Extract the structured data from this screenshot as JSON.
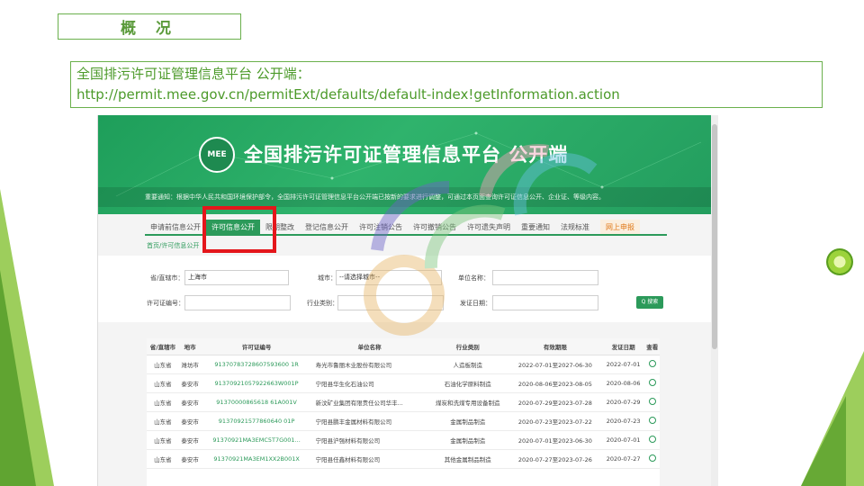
{
  "slide": {
    "title": "概 况",
    "info_line1": "全国排污许可证管理信息平台 公开端：",
    "info_line2": "http://permit.mee.gov.cn/permitExt/defaults/default-index!getInformation.action"
  },
  "site": {
    "logo_text": "MEE",
    "banner_title": "全国排污许可证管理信息平台 公开端",
    "notice": "重要通知：根据中华人民共和国环境保护部令，全国排污许可证管理信息平台公开端已按新的要求进行调整，可通过本页面查询许可证信息公开、企业证、等级内容。",
    "nav": [
      {
        "label": "申请前信息公开",
        "active": false
      },
      {
        "label": "许可信息公开",
        "active": true
      },
      {
        "label": "限期整改",
        "active": false
      },
      {
        "label": "登记信息公开",
        "active": false
      },
      {
        "label": "许可注销公告",
        "active": false
      },
      {
        "label": "许可撤销公告",
        "active": false
      },
      {
        "label": "许可遗失声明",
        "active": false
      },
      {
        "label": "重要通知",
        "active": false
      },
      {
        "label": "法规标准",
        "active": false
      },
      {
        "label": "网上申报",
        "active": false,
        "online": true
      }
    ],
    "breadcrumb": "首页/许可信息公开"
  },
  "filters": {
    "province_label": "省/直辖市：",
    "province_value": "上海市",
    "city_label": "城市：",
    "city_value": "--请选择城市--",
    "unit_label": "单位名称：",
    "license_label": "许可证编号：",
    "industry_label": "行业类别：",
    "date_label": "发证日期：",
    "search_label": "Q 搜索"
  },
  "table": {
    "headers": [
      "省/直辖市",
      "地市",
      "许可证编号",
      "单位名称",
      "行业类别",
      "有效期限",
      "发证日期",
      "查看"
    ],
    "rows": [
      [
        "山东省",
        "潍坊市",
        "91370783728607593600 1R",
        "寿光市鲁丽木业股份有限公司",
        "人造板制造",
        "2022-07-01至2027-06-30",
        "2022-07-01"
      ],
      [
        "山东省",
        "泰安市",
        "91370921057922663W001P",
        "宁阳县华生化石油公司",
        "石油化学原料制造",
        "2020-08-06至2023-08-05",
        "2020-08-06"
      ],
      [
        "山东省",
        "泰安市",
        "91370000865618 61A001V",
        "新汶矿业集团有限责任公司华丰...",
        "煤炭和洗煤专用设备制造",
        "2020-07-29至2023-07-28",
        "2020-07-29"
      ],
      [
        "山东省",
        "泰安市",
        "91370921577860640 01P",
        "宁阳县鹏丰金属材料有限公司",
        "金属制品制造",
        "2020-07-23至2023-07-22",
        "2020-07-23"
      ],
      [
        "山东省",
        "泰安市",
        "91370921MA3EMC5T7G001...",
        "宁阳县沪强材料有限公司",
        "金属制品制造",
        "2020-07-01至2023-06-30",
        "2020-07-01"
      ],
      [
        "山东省",
        "泰安市",
        "91370921MA3EM1XX2B001X",
        "宁阳县任鑫材料有限公司",
        "其他金属制品制造",
        "2020-07-27至2023-07-26",
        "2020-07-27"
      ]
    ]
  },
  "colors": {
    "accent_green": "#2c9a5a",
    "highlight_red": "#e4161b",
    "slide_green": "#5a9a3a"
  }
}
